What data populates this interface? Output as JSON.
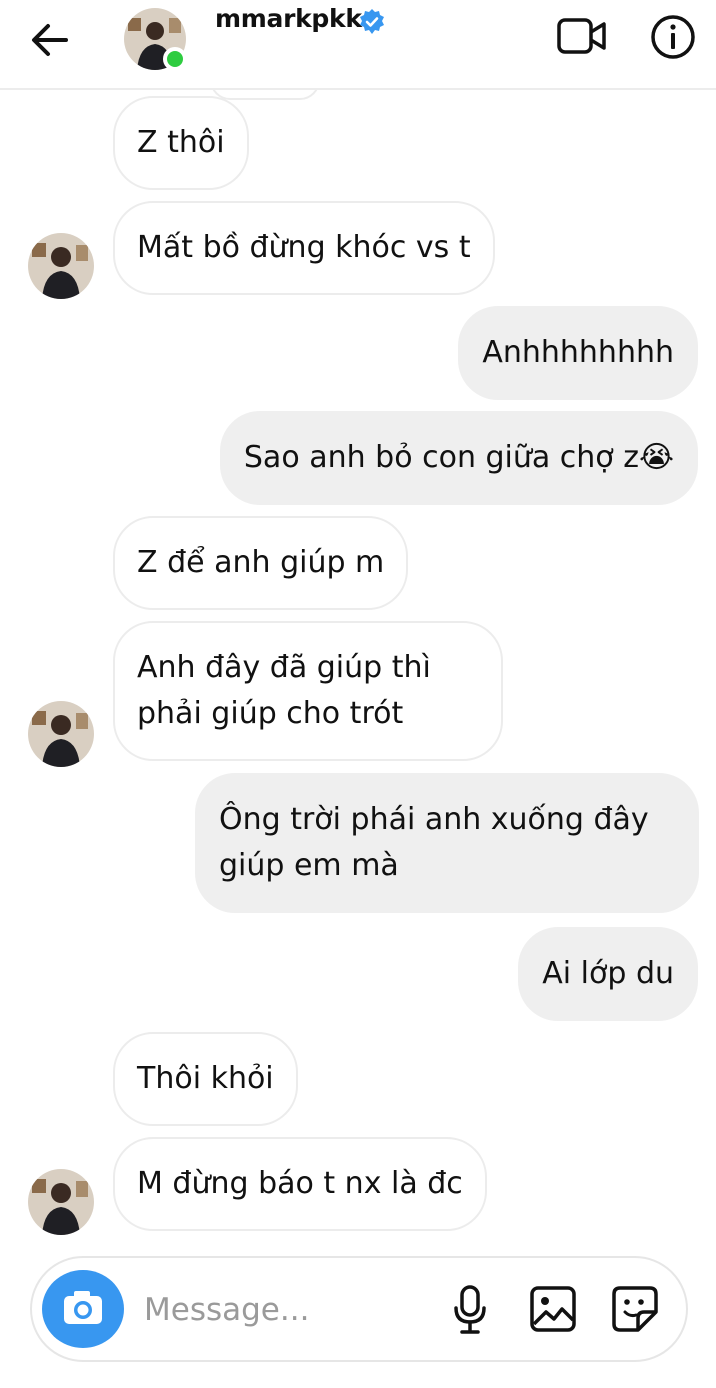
{
  "header": {
    "username": "mmarkpkk",
    "online": true,
    "verified": true
  },
  "messages": [
    {
      "sender": "them",
      "text": "Z thôi",
      "avatar": false
    },
    {
      "sender": "them",
      "text": "Mất bồ đừng khóc vs t",
      "avatar": true
    },
    {
      "sender": "me",
      "text": "Anhhhhhhhh"
    },
    {
      "sender": "me",
      "text": "Sao anh bỏ con giữa chợ z😭"
    },
    {
      "sender": "them",
      "text": "Z để anh giúp m",
      "avatar": false
    },
    {
      "sender": "them",
      "text": "Anh đây đã giúp thì phải giúp cho trót",
      "avatar": true
    },
    {
      "sender": "me",
      "text": "Ông trời phái anh xuống đây giúp em mà"
    },
    {
      "sender": "me",
      "text": "Ai lớp du"
    },
    {
      "sender": "them",
      "text": "Thôi khỏi",
      "avatar": false
    },
    {
      "sender": "them",
      "text": "M đừng báo t nx là đc",
      "avatar": true
    }
  ],
  "composer": {
    "placeholder": "Message..."
  },
  "colors": {
    "accent": "#3897f0",
    "online": "#2ecc40",
    "outgoing_bubble": "#efefef"
  },
  "icons": [
    "back-arrow-icon",
    "verified-badge-icon",
    "video-call-icon",
    "info-icon",
    "camera-icon",
    "microphone-icon",
    "gallery-icon",
    "sticker-icon"
  ]
}
